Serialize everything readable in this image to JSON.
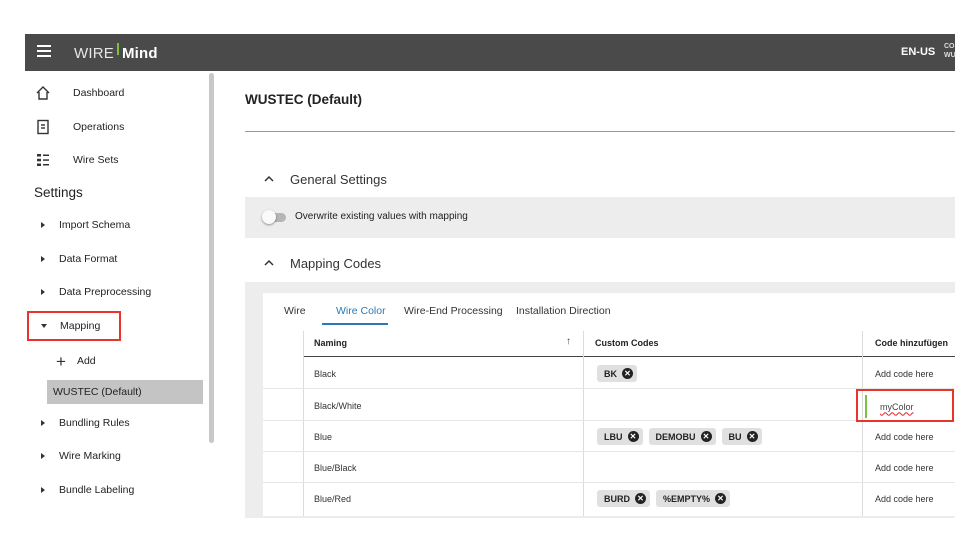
{
  "header": {
    "logo_left": "WIRE",
    "logo_right": "Mind",
    "language": "EN-US",
    "company_line1": "CO",
    "company_line2": "WU"
  },
  "sidebar": {
    "top_items": [
      {
        "label": "Dashboard",
        "icon": "home-icon"
      },
      {
        "label": "Operations",
        "icon": "document-icon"
      },
      {
        "label": "Wire Sets",
        "icon": "list-icon"
      }
    ],
    "settings_title": "Settings",
    "settings_items": [
      {
        "label": "Import Schema",
        "expanded": false
      },
      {
        "label": "Data Format",
        "expanded": false
      },
      {
        "label": "Data Preprocessing",
        "expanded": false
      },
      {
        "label": "Mapping",
        "expanded": true
      },
      {
        "label": "Bundling Rules",
        "expanded": false
      },
      {
        "label": "Wire Marking",
        "expanded": false
      },
      {
        "label": "Bundle Labeling",
        "expanded": false
      }
    ],
    "mapping_children": {
      "add_label": "Add",
      "selected": "WUSTEC (Default)"
    }
  },
  "main": {
    "title": "WUSTEC (Default)",
    "general_settings": {
      "label": "General Settings",
      "toggle_label": "Overwrite existing values with mapping",
      "toggle_on": false
    },
    "mapping_codes": {
      "label": "Mapping Codes",
      "tabs": [
        {
          "label": "Wire",
          "active": false
        },
        {
          "label": "Wire Color",
          "active": true
        },
        {
          "label": "Wire-End Processing",
          "active": false
        },
        {
          "label": "Installation Direction",
          "active": false
        }
      ],
      "columns": {
        "naming": "Naming",
        "custom_codes": "Custom Codes",
        "add_code": "Code hinzufügen"
      },
      "rows": [
        {
          "naming": "Black",
          "codes": [
            "BK"
          ],
          "add": "Add code here"
        },
        {
          "naming": "Black/White",
          "codes": [],
          "add": "myColor"
        },
        {
          "naming": "Blue",
          "codes": [
            "LBU",
            "DEMOBU",
            "BU"
          ],
          "add": "Add code here"
        },
        {
          "naming": "Blue/Black",
          "codes": [],
          "add": "Add code here"
        },
        {
          "naming": "Blue/Red",
          "codes": [
            "BURD",
            "%EMPTY%"
          ],
          "add": "Add code here"
        }
      ]
    }
  },
  "colors": {
    "header_bg": "#4a4a4a",
    "accent_blue": "#2a7ab8",
    "highlight_red": "#e8342a",
    "logo_green": "#7ac143"
  }
}
